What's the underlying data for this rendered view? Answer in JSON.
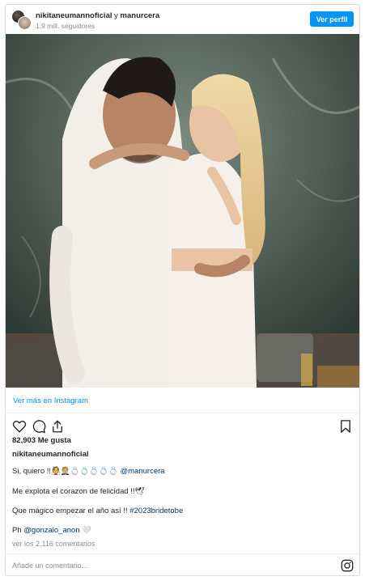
{
  "header": {
    "account1": "nikitaneumannoficial",
    "separator": "y",
    "account2": "manurcera",
    "followers": "1,9 mill. seguidores",
    "follow_button": "Ver perfil"
  },
  "post": {
    "view_more": "Ver más en Instagram",
    "likes": "82,903 Me gusta",
    "username": "nikitaneumannoficial",
    "caption_line1_text": "Si, quiero !!👰🤵🏼💍💍💍💍💍 ",
    "caption_line1_mention": "@manurcera",
    "caption_line2": "Me explota el corazon de felicidad !!🕊",
    "caption_line3_text": "Que mágico empezar el año así !! ",
    "caption_line3_tag": "#2023bridetobe",
    "caption_line4_text": "Ph ",
    "caption_line4_mention": "@gonzalo_anon",
    "caption_line4_suffix": " 🤍",
    "comments": "ver los 2,116 comentarios",
    "add_comment_placeholder": "Añade un comentario..."
  },
  "icons": {
    "like": "heart-icon",
    "comment": "comment-icon",
    "share": "share-icon",
    "save": "bookmark-icon",
    "brand": "instagram-icon"
  },
  "colors": {
    "accent": "#0095f6",
    "link": "#00376b",
    "muted": "#8e8e8e",
    "border": "#dbdbdb"
  }
}
